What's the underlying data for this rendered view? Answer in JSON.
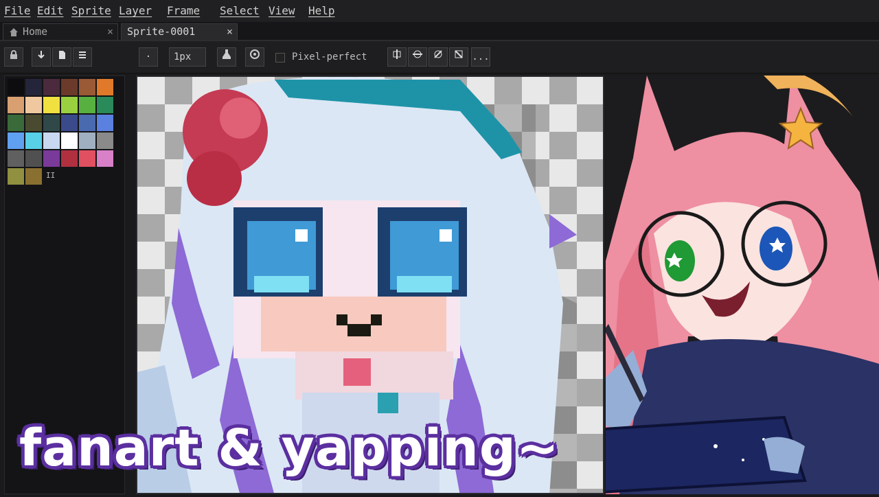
{
  "menu": [
    "File",
    "Edit",
    "Sprite",
    "Layer",
    "Frame",
    "Select",
    "View",
    "Help"
  ],
  "tabs": [
    {
      "label": "Home",
      "close": "×"
    },
    {
      "label": "Sprite-0001",
      "close": "×"
    }
  ],
  "toolbar": {
    "dot_label": "·",
    "brush_size": "1px",
    "pixel_perfect_label": "Pixel-perfect",
    "more_label": "..."
  },
  "palette": {
    "colors": [
      "#0d0d0f",
      "#24243a",
      "#4a2a3c",
      "#6b3a2a",
      "#9a5a36",
      "#e07a2a",
      "#d8a070",
      "#f0c8a0",
      "#f0e040",
      "#9ad040",
      "#58b040",
      "#2a8a5a",
      "#3a6a3a",
      "#4a4a30",
      "#304848",
      "#3a4a8a",
      "#4a6ab0",
      "#5a80e0",
      "#60a0f0",
      "#58d0e8",
      "#c8d8f0",
      "#ffffff",
      "#a0b0c0",
      "#8a8a8a",
      "#606060",
      "#505050",
      "#7a3a9a",
      "#b03040",
      "#e05060",
      "#d880c8",
      "#909040",
      "#8a7030"
    ],
    "pause_icon": "II"
  },
  "overlay_text": "fanart & yapping~",
  "colors": {
    "menubar_bg": "#202022",
    "overlay_fill": "#ffffff",
    "overlay_outline": "#5b2fa0",
    "checker_light": "#e8e8e8",
    "checker_dark": "#a9a9a9"
  }
}
